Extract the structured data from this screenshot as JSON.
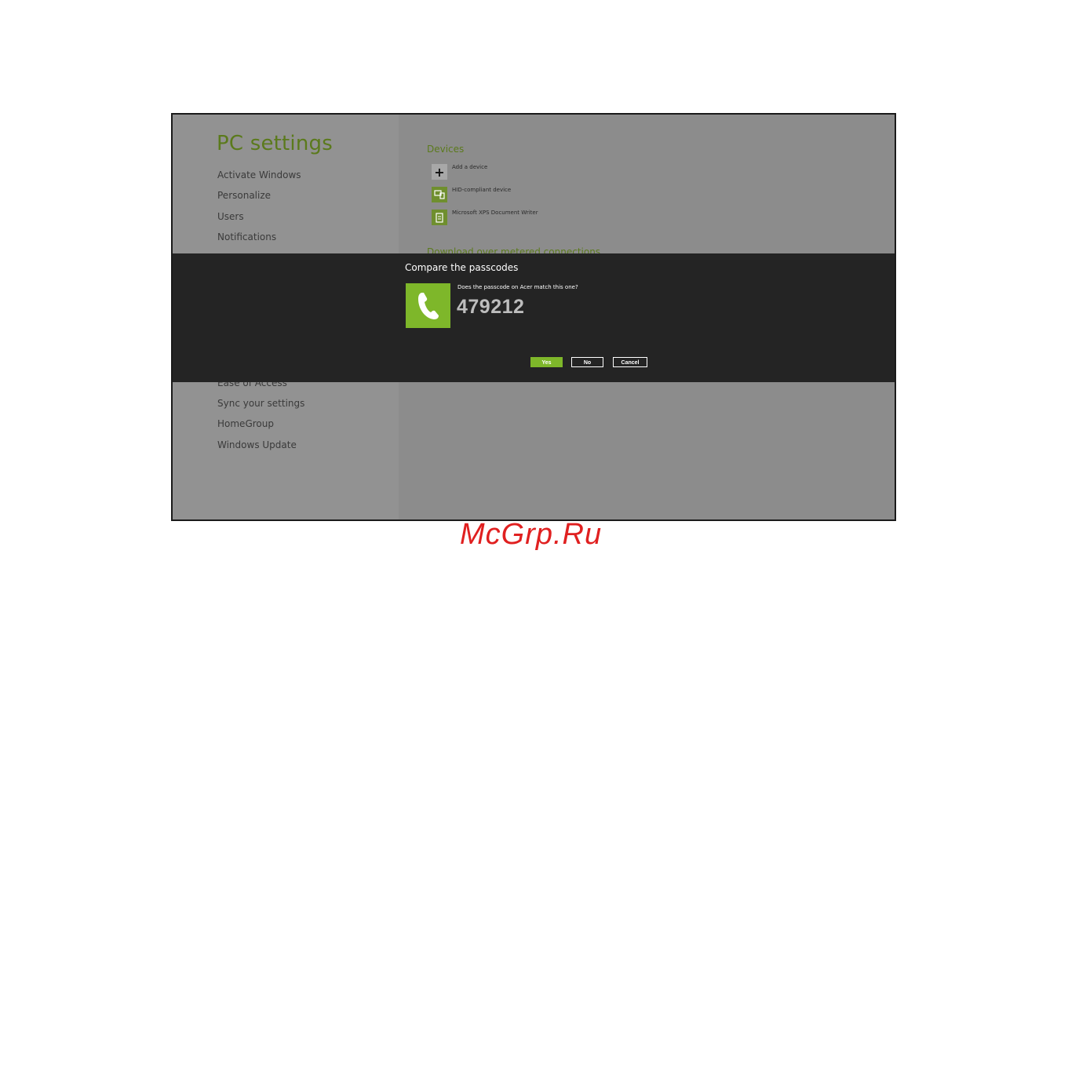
{
  "left_nav": {
    "title": "PC settings",
    "items_top": [
      "Activate Windows",
      "Personalize",
      "Users",
      "Notifications"
    ],
    "items_bottom": [
      "Ease of Access",
      "Sync your settings",
      "HomeGroup",
      "Windows Update"
    ]
  },
  "devices": {
    "section_title": "Devices",
    "items": [
      {
        "label": "Add a device",
        "icon": "plus-icon"
      },
      {
        "label": "HID-compliant device",
        "icon": "device-icon"
      },
      {
        "label": "Microsoft XPS Document Writer",
        "icon": "printer-document-icon"
      }
    ],
    "next_section_title": "Download over metered connections"
  },
  "dialog": {
    "title": "Compare the passcodes",
    "question": "Does the passcode on Acer match this one?",
    "passcode": "479212",
    "yes_label": "Yes",
    "no_label": "No",
    "cancel_label": "Cancel"
  },
  "colors": {
    "accent_green": "#7eb72a",
    "title_green": "#5b7a1c",
    "dialog_bg": "#242424"
  },
  "watermark": "McGrp.Ru"
}
